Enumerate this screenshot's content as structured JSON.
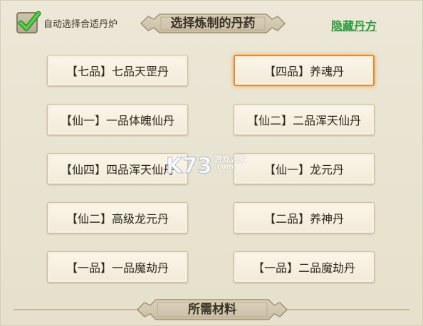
{
  "header": {
    "auto_select_label": "自动选择合适丹炉",
    "auto_select_checked": true,
    "title": "选择炼制的丹药",
    "hide_recipe_link": "隐藏丹方"
  },
  "recipes": [
    {
      "label": "【七品】七品天罡丹",
      "selected": false
    },
    {
      "label": "【四品】养魂丹",
      "selected": true
    },
    {
      "label": "【仙一】一品体魄仙丹",
      "selected": false
    },
    {
      "label": "【仙二】二品浑天仙丹",
      "selected": false
    },
    {
      "label": "【仙四】四品浑天仙丹",
      "selected": false
    },
    {
      "label": "【仙一】龙元丹",
      "selected": false
    },
    {
      "label": "【仙二】高级龙元丹",
      "selected": false
    },
    {
      "label": "【二品】养神丹",
      "selected": false
    },
    {
      "label": "【一品】一品魔劫丹",
      "selected": false
    },
    {
      "label": "【一品】二品魔劫丹",
      "selected": false
    }
  ],
  "footer": {
    "materials_title": "所需材料"
  },
  "watermark": {
    "logo": "K73",
    "text": "游戏之家",
    "sub": ".com"
  },
  "colors": {
    "background": "#e9e4d3",
    "accent_link": "#2c9a3e",
    "selected_border": "#e58a2a",
    "check_green": "#3bb33a"
  },
  "icons": {
    "checkbox": "checkmark-icon",
    "banner": "ornate-banner-icon"
  }
}
